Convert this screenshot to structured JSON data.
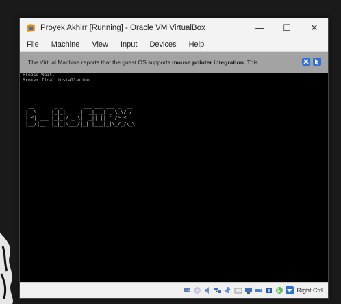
{
  "window": {
    "title": "Proyek Akhirr [Running] - Oracle VM VirtualBox",
    "minimize": "—",
    "maximize": "☐",
    "close": "✕"
  },
  "menu": {
    "items": [
      "File",
      "Machine",
      "View",
      "Input",
      "Devices",
      "Help"
    ]
  },
  "notice": {
    "text_before": "The Virtual Machine reports that the guest OS supports ",
    "text_bold": "mouse pointer integration",
    "text_after": ". This"
  },
  "console": {
    "lines": [
      "Please Wait.",
      "Broker final installation",
      "........"
    ]
  },
  "banner": {
    "lines": [
      " __       _ _       ___ ___ ___ _  __",
      "|  \\     |_|_|     |  _|_ _| _ \\ \\/ /",
      "| <| ___ |_|_|/ _ \\|  _|| || ' /> < ",
      "|__/|__| |_|_|\\___/|_| |___|_|\\_/_/\\_\\"
    ]
  },
  "statusbar": {
    "icons": [
      "hard-disk-icon",
      "optical-drive-icon",
      "audio-icon",
      "network-icon",
      "usb-icon",
      "shared-folders-icon",
      "display-icon",
      "video-capture-icon",
      "cpu-icon",
      "mouse-integration-icon",
      "host-key-icon"
    ],
    "host_key": "Right Ctrl"
  },
  "colors": {
    "titlebar": "#f3f3f3",
    "notice_bg": "#a3a3a3",
    "screen": "#000000",
    "accent": "#2d6fd8"
  }
}
